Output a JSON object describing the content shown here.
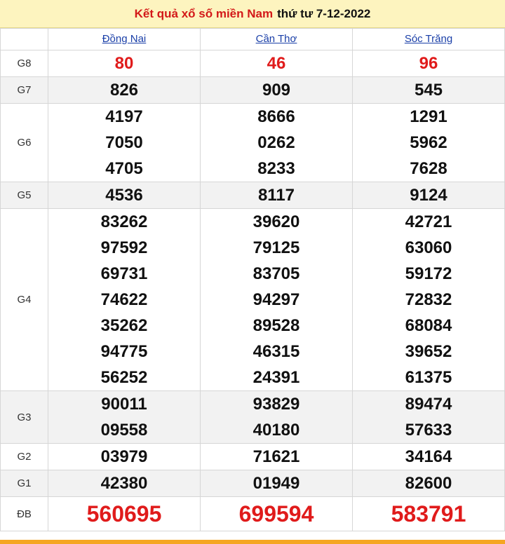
{
  "title": {
    "part1": "Kết quả xổ số miền Nam",
    "part2": "thứ tư 7-12-2022"
  },
  "provinces": [
    "Đồng Nai",
    "Cần Thơ",
    "Sóc Trăng"
  ],
  "prizes": [
    {
      "label": "G8",
      "values": [
        [
          "80"
        ],
        [
          "46"
        ],
        [
          "96"
        ]
      ]
    },
    {
      "label": "G7",
      "values": [
        [
          "826"
        ],
        [
          "909"
        ],
        [
          "545"
        ]
      ]
    },
    {
      "label": "G6",
      "values": [
        [
          "4197",
          "7050",
          "4705"
        ],
        [
          "8666",
          "0262",
          "8233"
        ],
        [
          "1291",
          "5962",
          "7628"
        ]
      ]
    },
    {
      "label": "G5",
      "values": [
        [
          "4536"
        ],
        [
          "8117"
        ],
        [
          "9124"
        ]
      ]
    },
    {
      "label": "G4",
      "values": [
        [
          "83262",
          "97592",
          "69731",
          "74622",
          "35262",
          "94775",
          "56252"
        ],
        [
          "39620",
          "79125",
          "83705",
          "94297",
          "89528",
          "46315",
          "24391"
        ],
        [
          "42721",
          "63060",
          "59172",
          "72832",
          "68084",
          "39652",
          "61375"
        ]
      ]
    },
    {
      "label": "G3",
      "values": [
        [
          "90011",
          "09558"
        ],
        [
          "93829",
          "40180"
        ],
        [
          "89474",
          "57633"
        ]
      ]
    },
    {
      "label": "G2",
      "values": [
        [
          "03979"
        ],
        [
          "71621"
        ],
        [
          "34164"
        ]
      ]
    },
    {
      "label": "G1",
      "values": [
        [
          "42380"
        ],
        [
          "01949"
        ],
        [
          "82600"
        ]
      ]
    },
    {
      "label": "ĐB",
      "values": [
        [
          "560695"
        ],
        [
          "699594"
        ],
        [
          "583791"
        ]
      ]
    }
  ],
  "colors": {
    "highlight": "#e01b1b",
    "header_bg": "#fdf4bf",
    "link": "#1a3fa8",
    "bottom_bar": "#f5a623"
  }
}
